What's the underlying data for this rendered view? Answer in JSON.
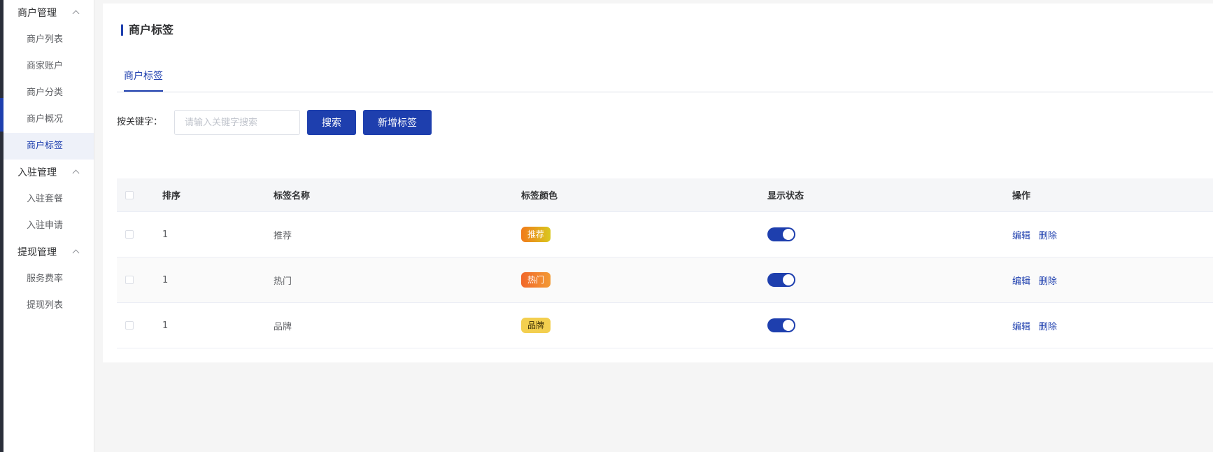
{
  "sidebar": {
    "groups": [
      {
        "label": "商户管理",
        "items": [
          "商户列表",
          "商家账户",
          "商户分类",
          "商户概况",
          "商户标签"
        ]
      },
      {
        "label": "入驻管理",
        "items": [
          "入驻套餐",
          "入驻申请"
        ]
      },
      {
        "label": "提现管理",
        "items": [
          "服务费率",
          "提现列表"
        ]
      }
    ],
    "active_item": "商户标签"
  },
  "page": {
    "title": "商户标签"
  },
  "tabs": [
    {
      "label": "商户标签",
      "active": true
    }
  ],
  "search": {
    "label": "按关键字：",
    "placeholder": "请输入关键字搜索",
    "value": ""
  },
  "buttons": {
    "search": "搜索",
    "add": "新增标签"
  },
  "table": {
    "columns": [
      "排序",
      "标签名称",
      "标签颜色",
      "显示状态",
      "操作"
    ],
    "rows": [
      {
        "sort": "1",
        "name": "推荐",
        "tag_text": "推荐",
        "status_on": true,
        "edit": "编辑",
        "delete": "删除"
      },
      {
        "sort": "1",
        "name": "热门",
        "tag_text": "热门",
        "status_on": true,
        "edit": "编辑",
        "delete": "删除"
      },
      {
        "sort": "1",
        "name": "品牌",
        "tag_text": "品牌",
        "status_on": true,
        "edit": "编辑",
        "delete": "删除"
      }
    ]
  },
  "colors": {
    "primary": "#1e3fae",
    "tag_recommend": "#f17a1b",
    "tag_hot": "#f1672a",
    "tag_brand": "#f3cf4f"
  }
}
